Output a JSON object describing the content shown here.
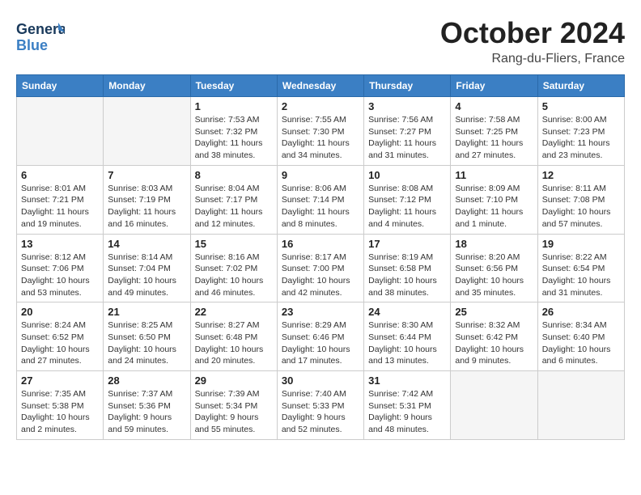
{
  "header": {
    "logo": {
      "general": "General",
      "blue": "Blue"
    },
    "title": "October 2024",
    "location": "Rang-du-Fliers, France"
  },
  "weekdays": [
    "Sunday",
    "Monday",
    "Tuesday",
    "Wednesday",
    "Thursday",
    "Friday",
    "Saturday"
  ],
  "weeks": [
    [
      {
        "day": "",
        "info": ""
      },
      {
        "day": "",
        "info": ""
      },
      {
        "day": "1",
        "info": "Sunrise: 7:53 AM\nSunset: 7:32 PM\nDaylight: 11 hours and 38 minutes."
      },
      {
        "day": "2",
        "info": "Sunrise: 7:55 AM\nSunset: 7:30 PM\nDaylight: 11 hours and 34 minutes."
      },
      {
        "day": "3",
        "info": "Sunrise: 7:56 AM\nSunset: 7:27 PM\nDaylight: 11 hours and 31 minutes."
      },
      {
        "day": "4",
        "info": "Sunrise: 7:58 AM\nSunset: 7:25 PM\nDaylight: 11 hours and 27 minutes."
      },
      {
        "day": "5",
        "info": "Sunrise: 8:00 AM\nSunset: 7:23 PM\nDaylight: 11 hours and 23 minutes."
      }
    ],
    [
      {
        "day": "6",
        "info": "Sunrise: 8:01 AM\nSunset: 7:21 PM\nDaylight: 11 hours and 19 minutes."
      },
      {
        "day": "7",
        "info": "Sunrise: 8:03 AM\nSunset: 7:19 PM\nDaylight: 11 hours and 16 minutes."
      },
      {
        "day": "8",
        "info": "Sunrise: 8:04 AM\nSunset: 7:17 PM\nDaylight: 11 hours and 12 minutes."
      },
      {
        "day": "9",
        "info": "Sunrise: 8:06 AM\nSunset: 7:14 PM\nDaylight: 11 hours and 8 minutes."
      },
      {
        "day": "10",
        "info": "Sunrise: 8:08 AM\nSunset: 7:12 PM\nDaylight: 11 hours and 4 minutes."
      },
      {
        "day": "11",
        "info": "Sunrise: 8:09 AM\nSunset: 7:10 PM\nDaylight: 11 hours and 1 minute."
      },
      {
        "day": "12",
        "info": "Sunrise: 8:11 AM\nSunset: 7:08 PM\nDaylight: 10 hours and 57 minutes."
      }
    ],
    [
      {
        "day": "13",
        "info": "Sunrise: 8:12 AM\nSunset: 7:06 PM\nDaylight: 10 hours and 53 minutes."
      },
      {
        "day": "14",
        "info": "Sunrise: 8:14 AM\nSunset: 7:04 PM\nDaylight: 10 hours and 49 minutes."
      },
      {
        "day": "15",
        "info": "Sunrise: 8:16 AM\nSunset: 7:02 PM\nDaylight: 10 hours and 46 minutes."
      },
      {
        "day": "16",
        "info": "Sunrise: 8:17 AM\nSunset: 7:00 PM\nDaylight: 10 hours and 42 minutes."
      },
      {
        "day": "17",
        "info": "Sunrise: 8:19 AM\nSunset: 6:58 PM\nDaylight: 10 hours and 38 minutes."
      },
      {
        "day": "18",
        "info": "Sunrise: 8:20 AM\nSunset: 6:56 PM\nDaylight: 10 hours and 35 minutes."
      },
      {
        "day": "19",
        "info": "Sunrise: 8:22 AM\nSunset: 6:54 PM\nDaylight: 10 hours and 31 minutes."
      }
    ],
    [
      {
        "day": "20",
        "info": "Sunrise: 8:24 AM\nSunset: 6:52 PM\nDaylight: 10 hours and 27 minutes."
      },
      {
        "day": "21",
        "info": "Sunrise: 8:25 AM\nSunset: 6:50 PM\nDaylight: 10 hours and 24 minutes."
      },
      {
        "day": "22",
        "info": "Sunrise: 8:27 AM\nSunset: 6:48 PM\nDaylight: 10 hours and 20 minutes."
      },
      {
        "day": "23",
        "info": "Sunrise: 8:29 AM\nSunset: 6:46 PM\nDaylight: 10 hours and 17 minutes."
      },
      {
        "day": "24",
        "info": "Sunrise: 8:30 AM\nSunset: 6:44 PM\nDaylight: 10 hours and 13 minutes."
      },
      {
        "day": "25",
        "info": "Sunrise: 8:32 AM\nSunset: 6:42 PM\nDaylight: 10 hours and 9 minutes."
      },
      {
        "day": "26",
        "info": "Sunrise: 8:34 AM\nSunset: 6:40 PM\nDaylight: 10 hours and 6 minutes."
      }
    ],
    [
      {
        "day": "27",
        "info": "Sunrise: 7:35 AM\nSunset: 5:38 PM\nDaylight: 10 hours and 2 minutes."
      },
      {
        "day": "28",
        "info": "Sunrise: 7:37 AM\nSunset: 5:36 PM\nDaylight: 9 hours and 59 minutes."
      },
      {
        "day": "29",
        "info": "Sunrise: 7:39 AM\nSunset: 5:34 PM\nDaylight: 9 hours and 55 minutes."
      },
      {
        "day": "30",
        "info": "Sunrise: 7:40 AM\nSunset: 5:33 PM\nDaylight: 9 hours and 52 minutes."
      },
      {
        "day": "31",
        "info": "Sunrise: 7:42 AM\nSunset: 5:31 PM\nDaylight: 9 hours and 48 minutes."
      },
      {
        "day": "",
        "info": ""
      },
      {
        "day": "",
        "info": ""
      }
    ]
  ]
}
